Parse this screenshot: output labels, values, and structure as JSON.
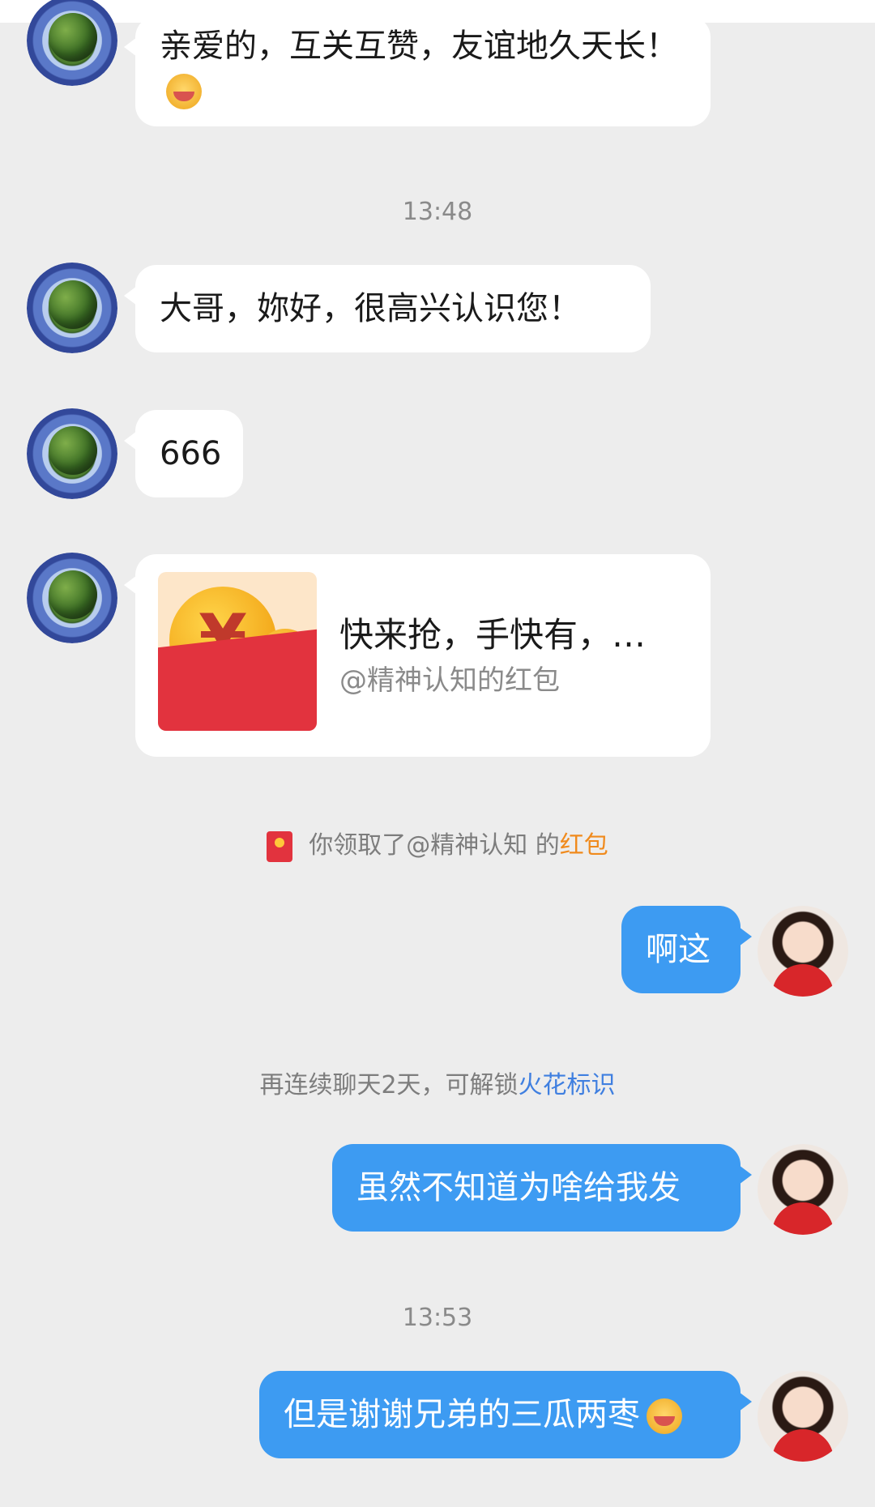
{
  "messages": {
    "m1": {
      "text": "亲爱的，互关互赞，友谊地久天长！"
    },
    "t1": "13:48",
    "m2": {
      "text": "大哥，妳好，很高兴认识您！"
    },
    "m3": {
      "text": "666"
    },
    "redpacket": {
      "title": "快来抢，手快有，…",
      "subtitle": "@精神认知的红包"
    },
    "sys1": {
      "prefix": "你领取了@精神认知 的",
      "highlight": "红包"
    },
    "m4": {
      "text": "啊这"
    },
    "sys2": {
      "prefix": "再连续聊天2天，可解锁",
      "highlight": "火花标识"
    },
    "m5": {
      "text": "虽然不知道为啥给我发"
    },
    "t2": "13:53",
    "m6": {
      "text": "但是谢谢兄弟的三瓜两枣"
    }
  },
  "colors": {
    "outgoing_bubble": "#3d9bf2",
    "incoming_bubble": "#ffffff",
    "background": "#ededed",
    "redpacket_link": "#f08a1c",
    "spark_link": "#3f7fe0"
  },
  "icons": [
    "globe-avatar-icon",
    "girl-avatar-icon",
    "red-envelope-icon",
    "smile-emoji-icon",
    "touched-emoji-icon"
  ]
}
